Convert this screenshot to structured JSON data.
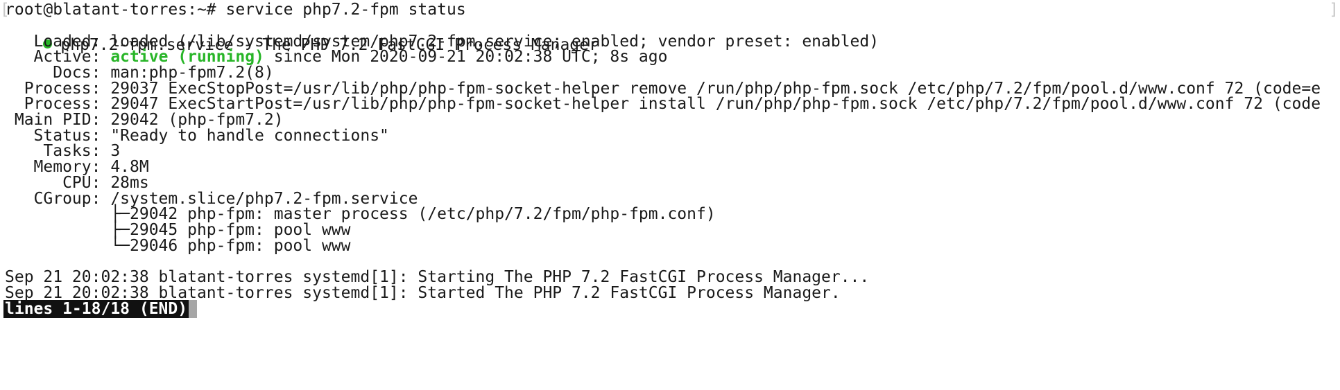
{
  "colors": {
    "background": "#ffffff",
    "text": "#1a1a1a",
    "active_green": "#28b528",
    "status_bar_bg": "#111111",
    "status_bar_fg": "#ffffff",
    "cursor": "#a6a6a6"
  },
  "terminal": {
    "prompt_line": "root@blatant-torres:~# service php7.2-fpm status",
    "open_bracket": "[",
    "close_bracket": "]",
    "service_dot_icon": "green-circle-icon",
    "service_header": "php7.2-fpm.service - The PHP 7.2 FastCGI Process Manager",
    "loaded": "   Loaded: loaded (/lib/systemd/system/php7.2-fpm.service; enabled; vendor preset: enabled)",
    "active_label": "   Active: ",
    "active_state": "active (running)",
    "active_since": " since Mon 2020-09-21 20:02:38 UTC; 8s ago",
    "docs": "     Docs: man:php-fpm7.2(8)",
    "process_1": "  Process: 29037 ExecStopPost=/usr/lib/php/php-fpm-socket-helper remove /run/php/php-fpm.sock /etc/php/7.2/fpm/pool.d/www.conf 72 (code=e",
    "process_2": "  Process: 29047 ExecStartPost=/usr/lib/php/php-fpm-socket-helper install /run/php/php-fpm.sock /etc/php/7.2/fpm/pool.d/www.conf 72 (code",
    "main_pid": " Main PID: 29042 (php-fpm7.2)",
    "status": "   Status: \"Ready to handle connections\"",
    "tasks": "    Tasks: 3",
    "memory": "   Memory: 4.8M",
    "cpu": "      CPU: 28ms",
    "cgroup": "   CGroup: /system.slice/php7.2-fpm.service",
    "cgroup_tree": [
      "           ├─29042 php-fpm: master process (/etc/php/7.2/fpm/php-fpm.conf)",
      "           ├─29045 php-fpm: pool www",
      "           └─29046 php-fpm: pool www"
    ],
    "log_lines": [
      "Sep 21 20:02:38 blatant-torres systemd[1]: Starting The PHP 7.2 FastCGI Process Manager...",
      "Sep 21 20:02:38 blatant-torres systemd[1]: Started The PHP 7.2 FastCGI Process Manager."
    ],
    "pager_status": "lines 1-18/18 (END)"
  }
}
